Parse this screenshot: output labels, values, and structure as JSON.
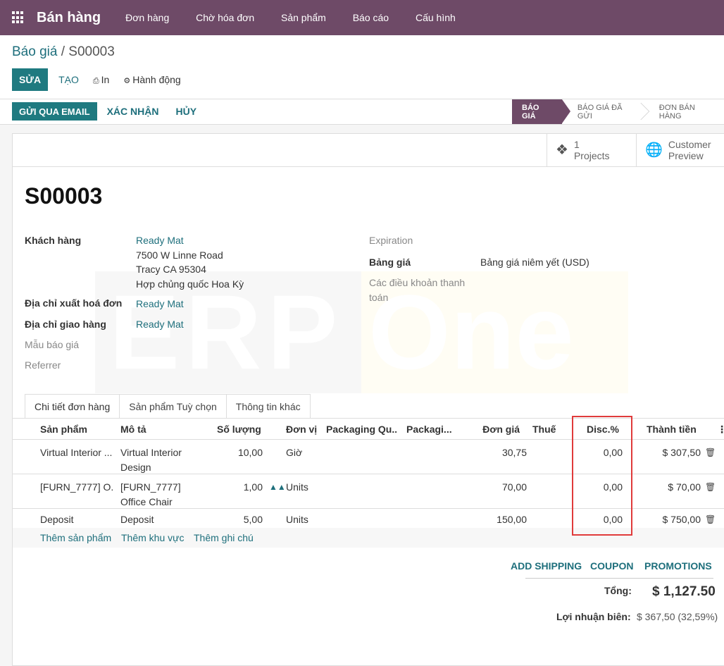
{
  "app": {
    "name": "Bán hàng",
    "nav": [
      "Đơn hàng",
      "Chờ hóa đơn",
      "Sản phẩm",
      "Báo cáo",
      "Cấu hình"
    ]
  },
  "breadcrumb": {
    "parent": "Báo giá",
    "separator": "/",
    "current": "S00003"
  },
  "toolbar": {
    "edit": "SỬA",
    "create": "TẠO",
    "print": "In",
    "action": "Hành động"
  },
  "status_actions": {
    "send_email": "GỬI QUA EMAIL",
    "confirm": "XÁC NHẬN",
    "cancel": "HỦY"
  },
  "stages": [
    "BÁO GIÁ",
    "BÁO GIÁ ĐÃ GỬI",
    "ĐƠN BÁN HÀNG"
  ],
  "smart_buttons": {
    "projects": {
      "count": "1",
      "label": "Projects"
    },
    "preview": {
      "line1": "Customer",
      "line2": "Preview"
    }
  },
  "watermark": {
    "left": "ERP",
    "right": "One"
  },
  "record": {
    "title": "S00003",
    "customer_label": "Khách hàng",
    "customer_name": "Ready Mat",
    "customer_addr1": "7500 W Linne Road",
    "customer_addr2": "Tracy CA 95304",
    "customer_addr3": "Hợp chủng quốc Hoa Kỳ",
    "invoice_label": "Địa chỉ xuất hoá đơn",
    "invoice_value": "Ready Mat",
    "delivery_label": "Địa chỉ giao hàng",
    "delivery_value": "Ready Mat",
    "template_label": "Mẫu báo giá",
    "referrer_label": "Referrer",
    "expiration_label": "Expiration",
    "pricelist_label": "Bảng giá",
    "pricelist_value": "Bảng giá niêm yết (USD)",
    "terms_label_1": "Các điều khoản thanh",
    "terms_label_2": "toán"
  },
  "tabs": [
    "Chi tiết đơn hàng",
    "Sản phẩm Tuỳ chọn",
    "Thông tin khác"
  ],
  "table": {
    "headers": {
      "product": "Sản phẩm",
      "desc": "Mô tả",
      "qty": "Số lượng",
      "uom": "Đơn vị",
      "pkg_qty": "Packaging Qu...",
      "pkg": "Packagi...",
      "price": "Đơn giá",
      "tax": "Thuế",
      "disc": "Disc.%",
      "subtotal": "Thành tiền"
    },
    "rows": [
      {
        "product": "Virtual Interior ...",
        "desc1": "Virtual Interior",
        "desc2": "Design",
        "qty": "10,00",
        "uom": "Giờ",
        "price": "30,75",
        "disc": "0,00",
        "subtotal": "$ 307,50"
      },
      {
        "product": "[FURN_7777] O...",
        "desc1": "[FURN_7777]",
        "desc2": "Office Chair",
        "qty": "1,00",
        "uom": "Units",
        "price": "70,00",
        "disc": "0,00",
        "subtotal": "$ 70,00"
      },
      {
        "product": "Deposit",
        "desc1": "Deposit",
        "desc2": "",
        "qty": "5,00",
        "uom": "Units",
        "price": "150,00",
        "disc": "0,00",
        "subtotal": "$ 750,00"
      }
    ],
    "add_product": "Thêm sản phẩm",
    "add_section": "Thêm khu vực",
    "add_note": "Thêm ghi chú"
  },
  "footer_actions": {
    "shipping": "ADD SHIPPING",
    "coupon": "COUPON",
    "promotions": "PROMOTIONS"
  },
  "totals": {
    "total_label": "Tổng:",
    "total_value": "$ 1,127.50",
    "margin_label": "Lợi nhuận biên:",
    "margin_value": "$ 367,50 (32,59%)"
  },
  "colors": {
    "brand": "#6e4a67",
    "primary": "#1f7a80",
    "link": "#1e6f7c",
    "highlight": "#e03b3b"
  }
}
